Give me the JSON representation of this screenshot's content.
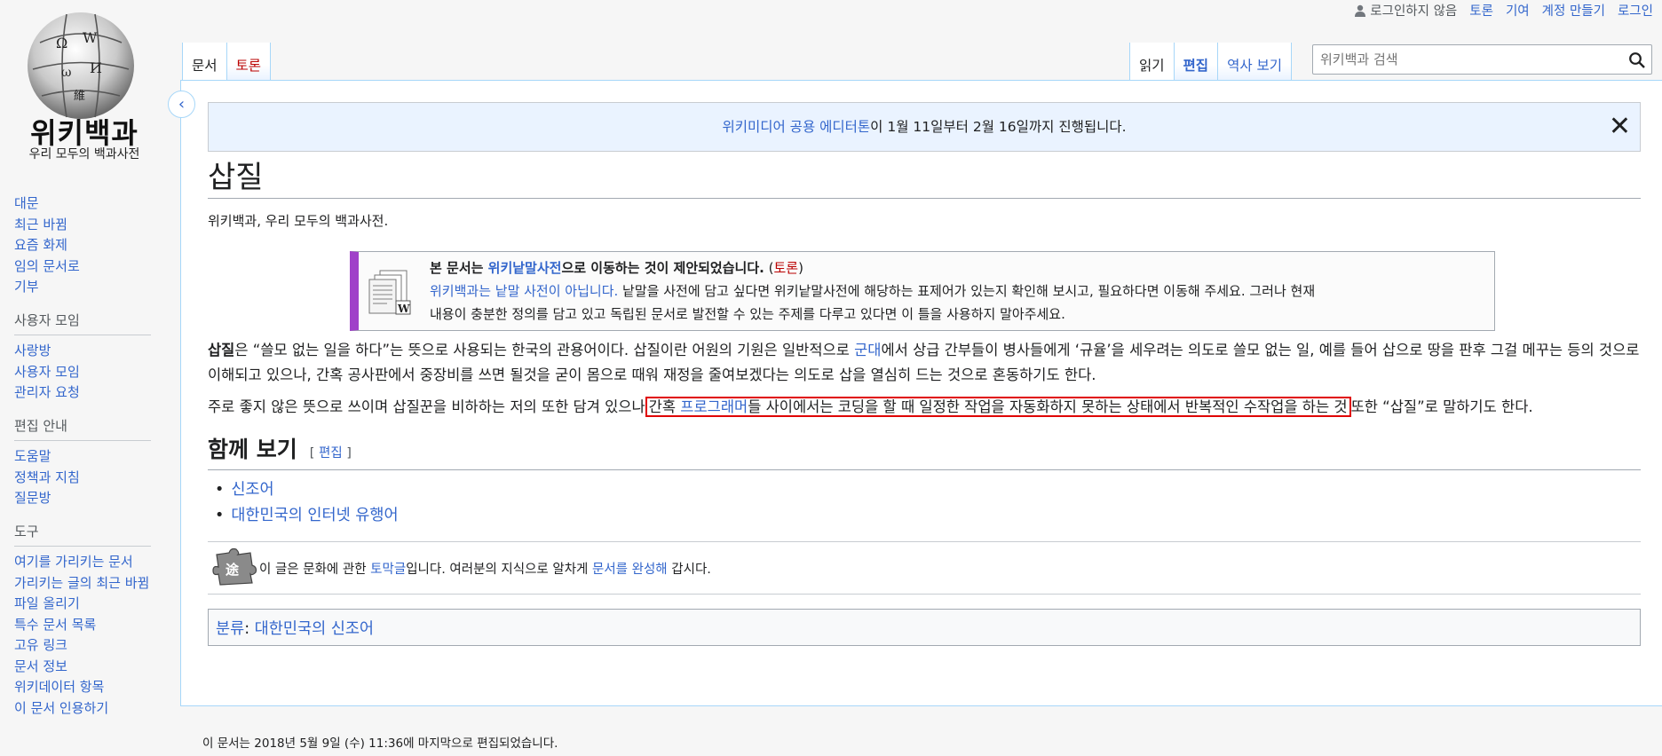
{
  "logo": {
    "wordmark": "위키백과",
    "tagline": "우리 모두의 백과사전"
  },
  "sidebar": {
    "navigation": [
      "대문",
      "최근 바뀜",
      "요즘 화제",
      "임의 문서로",
      "기부"
    ],
    "community": {
      "heading": "사용자 모임",
      "items": [
        "사랑방",
        "사용자 모임",
        "관리자 요청"
      ]
    },
    "help": {
      "heading": "편집 안내",
      "items": [
        "도움말",
        "정책과 지침",
        "질문방"
      ]
    },
    "tools": {
      "heading": "도구",
      "items": [
        "여기를 가리키는 문서",
        "가리키는 글의 최근 바뀜",
        "파일 올리기",
        "특수 문서 목록",
        "고유 링크",
        "문서 정보",
        "위키데이터 항목",
        "이 문서 인용하기"
      ]
    }
  },
  "personal": {
    "not_logged_in": "로그인하지 않음",
    "talk": "토론",
    "contributions": "기여",
    "create_account": "계정 만들기",
    "login": "로그인"
  },
  "tabs": {
    "article": "문서",
    "talk": "토론",
    "read": "읽기",
    "edit": "편집",
    "history": "역사 보기"
  },
  "search": {
    "placeholder": "위키백과 검색"
  },
  "notice": {
    "link": "위키미디어 공용 에디터톤",
    "text": "이 1월 11일부터 2월 16일까지 진행됩니다."
  },
  "article": {
    "title": "삽질",
    "subtitle": "위키백과, 우리 모두의 백과사전.",
    "ambox": {
      "line1_pre": "본 문서는 ",
      "line1_link": "위키낱말사전",
      "line1_post": "으로 이동하는 것이 제안되었습니다.",
      "line1_talk_open": " (",
      "line1_talk": "토론",
      "line1_talk_close": ")",
      "line2_link": "위키백과는 낱말 사전이 아닙니다.",
      "line2_text": " 낱말을 사전에 담고 싶다면 위키낱말사전에 해당하는 표제어가 있는지 확인해 보시고, 필요하다면 이동해 주세요. 그러나 현재",
      "line3_text": "내용이 충분한 정의를 담고 있고 독립된 문서로 발전할 수 있는 주제를 다루고 있다면 이 틀을 사용하지 말아주세요."
    },
    "p1": {
      "bold": "삽질",
      "t1": "은 “쓸모 없는 일을 하다”는 뜻으로 사용되는 한국의 관용어이다. 삽질이란 어원의 기원은 일반적으로 ",
      "link": "군대",
      "t2": "에서 상급 간부들이 병사들에게 ‘규율’을 세우려는 의도로 쓸모 없는 일, 예를 들어 삽으로 땅을 판후 그걸 메꾸는 등의 것으로 이해되고 있으나, 간혹 공사판에서 중장비를 쓰면 될것을 굳이 몸으로 때워 재정을 줄여보겠다는 의도로 삽을 열심히 드는 것으로 혼동하기도 한다."
    },
    "p2": {
      "t1": "주로 좋지 않은 뜻으로 쓰이며 삽질꾼을 비하하는 저의 또한 담겨 있으나",
      "h1": "간혹 ",
      "link": "프로그래머",
      "h2": "들 사이에서는 코딩을 할 때 일정한 작업을 자동화하지 못하는 상태에서 반복적인 수작업을 하는 것",
      "t2": "또한 “삽질”로 말하기도 한다."
    },
    "see_also": {
      "heading": "함께 보기",
      "edit_open": "[ ",
      "edit": "편집",
      "edit_close": " ]",
      "items": [
        "신조어",
        "대한민국의 인터넷 유행어"
      ]
    },
    "stub": {
      "t1": "이 글은 문화에 관한 ",
      "link1": "토막글",
      "t2": "입니다. 여러분의 지식으로 알차게 ",
      "link2": "문서를 완성해",
      "t3": " 갑시다."
    },
    "categories": {
      "label": "분류",
      "colon": ": ",
      "items": [
        "대한민국의 신조어"
      ]
    }
  },
  "footer": {
    "last_modified": "이 문서는 2018년 5월 9일 (수) 11:36에 마지막으로 편집되었습니다."
  },
  "colors": {
    "accent": "#3366cc",
    "tab_border": "#a7d7f9",
    "ambox_bar": "#a040c9",
    "highlight": "#e00000"
  }
}
